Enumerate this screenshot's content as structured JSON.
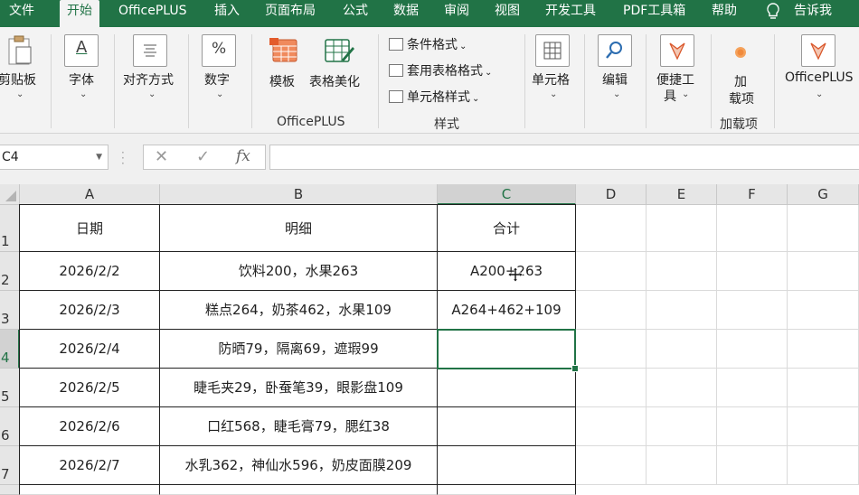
{
  "tabs": [
    {
      "label": "文件",
      "active": false
    },
    {
      "label": "开始",
      "active": true
    },
    {
      "label": "OfficePLUS",
      "active": false
    },
    {
      "label": "插入",
      "active": false
    },
    {
      "label": "页面布局",
      "active": false
    },
    {
      "label": "公式",
      "active": false
    },
    {
      "label": "数据",
      "active": false
    },
    {
      "label": "审阅",
      "active": false
    },
    {
      "label": "视图",
      "active": false
    },
    {
      "label": "开发工具",
      "active": false
    },
    {
      "label": "PDF工具箱",
      "active": false
    },
    {
      "label": "帮助",
      "active": false
    }
  ],
  "tell_me": "告诉我",
  "ribbon": {
    "clipboard": "剪贴板",
    "font": "字体",
    "alignment": "对齐方式",
    "number": "数字",
    "template": "模板",
    "table_beautify": "表格美化",
    "officeplus_group": "OfficePLUS",
    "conditional_format": "条件格式",
    "format_as_table": "套用表格格式",
    "cell_styles": "单元格样式",
    "styles_group": "样式",
    "cells": "单元格",
    "editing": "编辑",
    "quick_tools_1": "便捷工",
    "quick_tools_2": "具",
    "addins_1": "加",
    "addins_2": "载项",
    "addins_group": "加载项",
    "officeplus_btn": "OfficePLUS",
    "font_icon_glyph": "A",
    "number_icon_glyph": "%"
  },
  "formula_bar": {
    "name_box": "C4",
    "cancel_glyph": "✕",
    "enter_glyph": "✓",
    "fx_glyph": "fx",
    "value": ""
  },
  "columns": [
    "A",
    "B",
    "C",
    "D",
    "E",
    "F",
    "G"
  ],
  "rows": [
    "1",
    "2",
    "3",
    "4",
    "5",
    "6",
    "7"
  ],
  "selected_cell": "C4",
  "sheet": {
    "header": {
      "date": "日期",
      "detail": "明细",
      "total": "合计"
    },
    "rows": [
      {
        "date": "2026/2/2",
        "detail": "饮料200，水果263",
        "total": "A200+263"
      },
      {
        "date": "2026/2/3",
        "detail": "糕点264，奶茶462，水果109",
        "total": "A264+462+109"
      },
      {
        "date": "2026/2/4",
        "detail": "防晒79，隔离69，遮瑕99",
        "total": ""
      },
      {
        "date": "2026/2/5",
        "detail": "睫毛夹29，卧蚕笔39，眼影盘109",
        "total": ""
      },
      {
        "date": "2026/2/6",
        "detail": "口红568，睫毛膏79，腮红38",
        "total": ""
      },
      {
        "date": "2026/2/7",
        "detail": "水乳362，神仙水596，奶皮面膜209",
        "total": ""
      }
    ]
  },
  "colors": {
    "accent": "#217346",
    "ribbon_bg": "#f3f3f3",
    "header_bg": "#e6e6e6"
  }
}
